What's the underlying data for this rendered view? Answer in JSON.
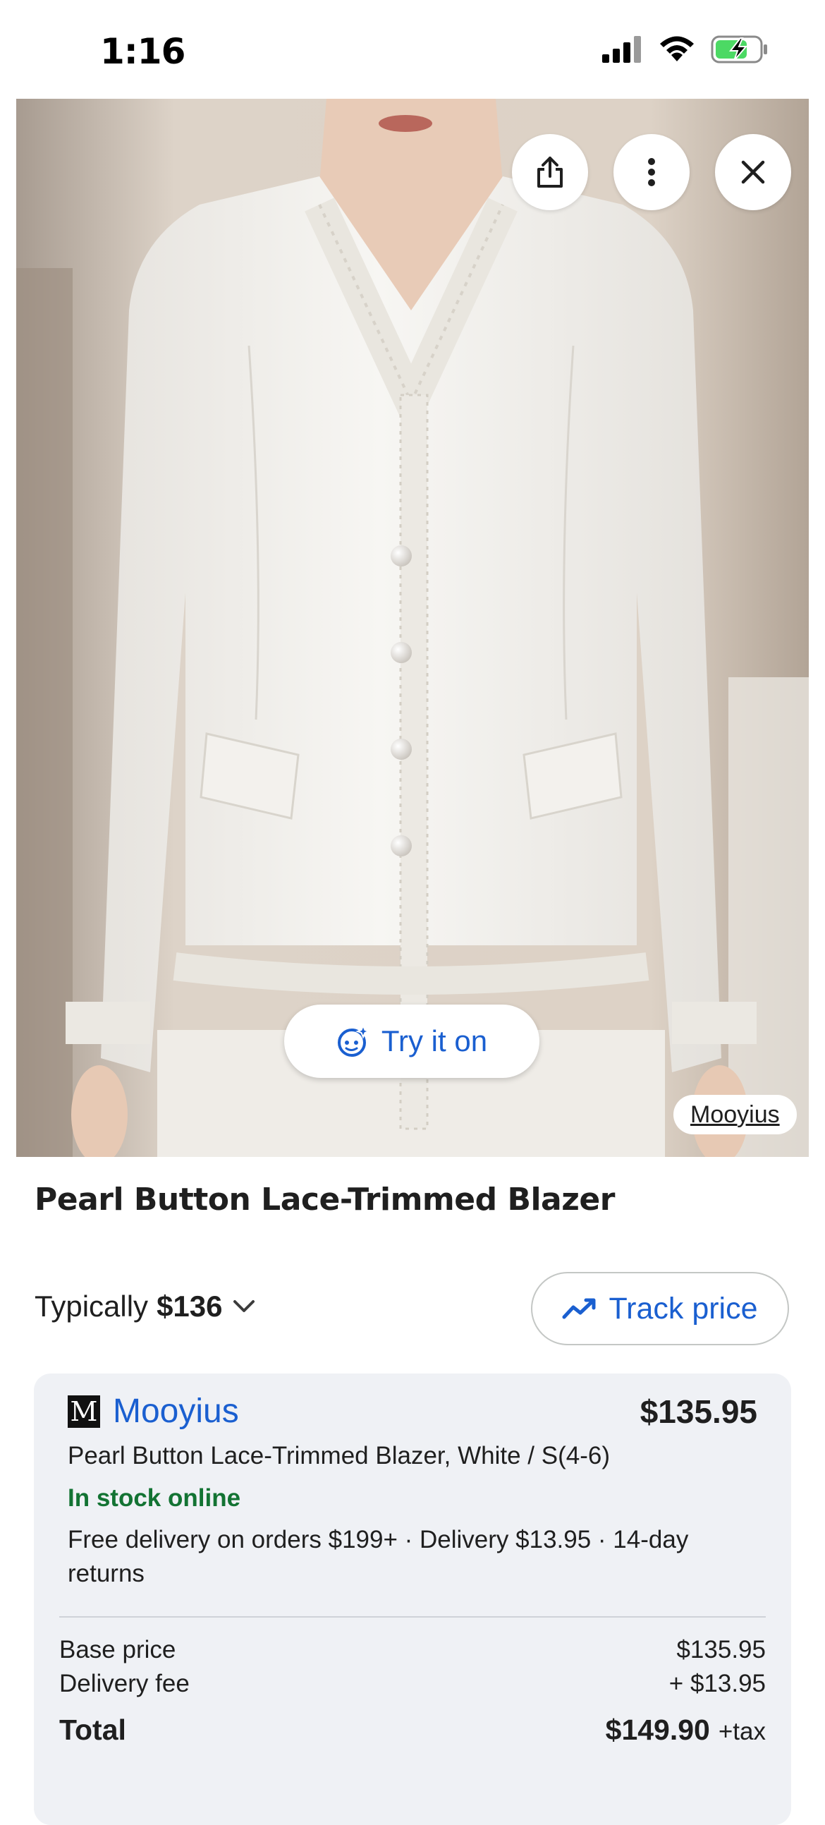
{
  "status_bar": {
    "time": "1:16"
  },
  "hero": {
    "try_on_label": "Try it on",
    "source_label": "Mooyius",
    "icons": [
      "share-icon",
      "more-vert-icon",
      "close-icon",
      "try-on-sparkle-icon"
    ]
  },
  "product": {
    "title": "Pearl Button Lace-Trimmed Blazer",
    "typically_label": "Typically",
    "typically_price": "$136",
    "track_price_label": "Track price"
  },
  "offer": {
    "store_logo": "M",
    "store_name": "Mooyius",
    "price": "$135.95",
    "variant": "Pearl Button Lace-Trimmed Blazer, White / S(4-6)",
    "stock": "In stock online",
    "delivery": "Free delivery on orders $199+ · Delivery $13.95 · 14-day returns",
    "base_price_label": "Base price",
    "base_price_value": "$135.95",
    "delivery_fee_label": "Delivery fee",
    "delivery_fee_value": "+ $13.95",
    "total_label": "Total",
    "total_value": "$149.90",
    "total_suffix": "+tax"
  },
  "colors": {
    "accent_blue": "#1a5fd0",
    "stock_green": "#137333",
    "card_bg": "#eff1f5"
  }
}
